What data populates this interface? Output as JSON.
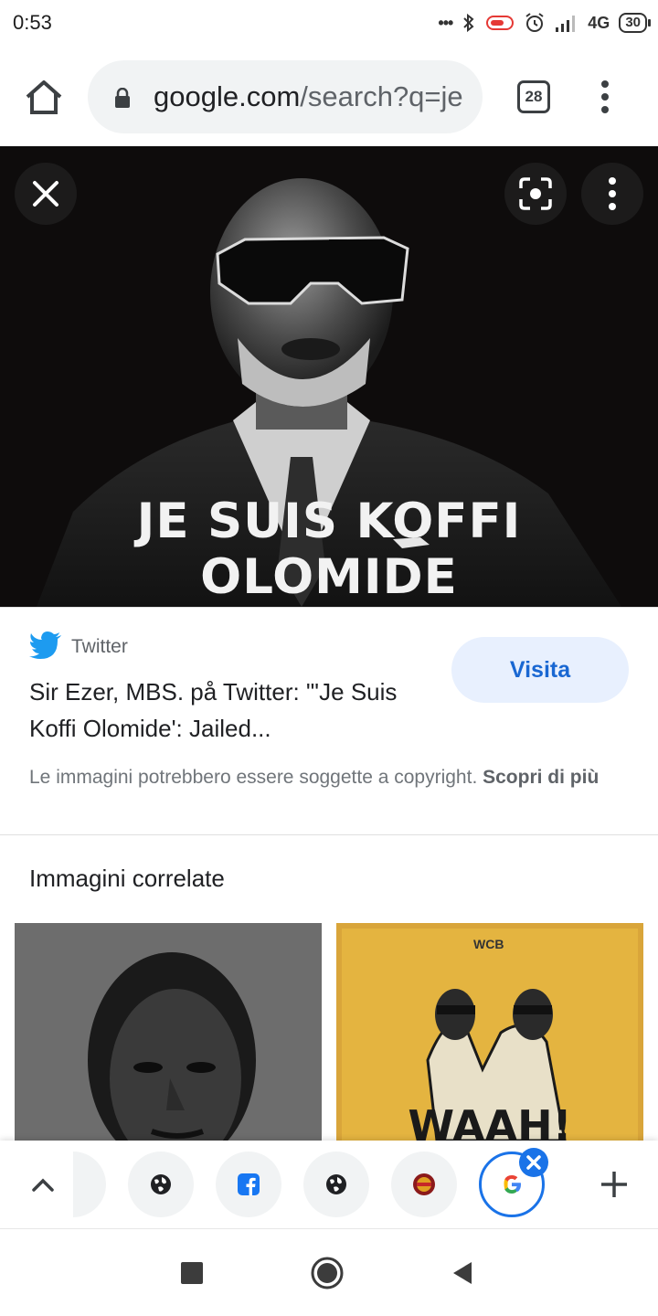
{
  "status_bar": {
    "time": "0:53",
    "dots": "•••",
    "network": "4G",
    "battery": "30"
  },
  "browser": {
    "url_domain": "google.com",
    "url_rest": "/search?q=je",
    "tab_count": "28"
  },
  "hero": {
    "caption": "JE SUIS KOFFI OLOMIDE"
  },
  "result": {
    "source": "Twitter",
    "title": "Sir Ezer, MBS. på Twitter: \"'Je Suis Koffi Olomide': Jailed...",
    "visit_label": "Visita",
    "copyright_text": "Le immagini potrebbero essere soggette a copyright.",
    "learn_more": "Scopri di più"
  },
  "related": {
    "title": "Immagini correlate",
    "thumb_right_text": "WAAH!",
    "thumb_right_logo": "WCB"
  },
  "colors": {
    "accent": "#1a73e8",
    "visit_bg": "#e8f0fe",
    "visit_text": "#1967d2",
    "twitter": "#1d9bf0"
  }
}
